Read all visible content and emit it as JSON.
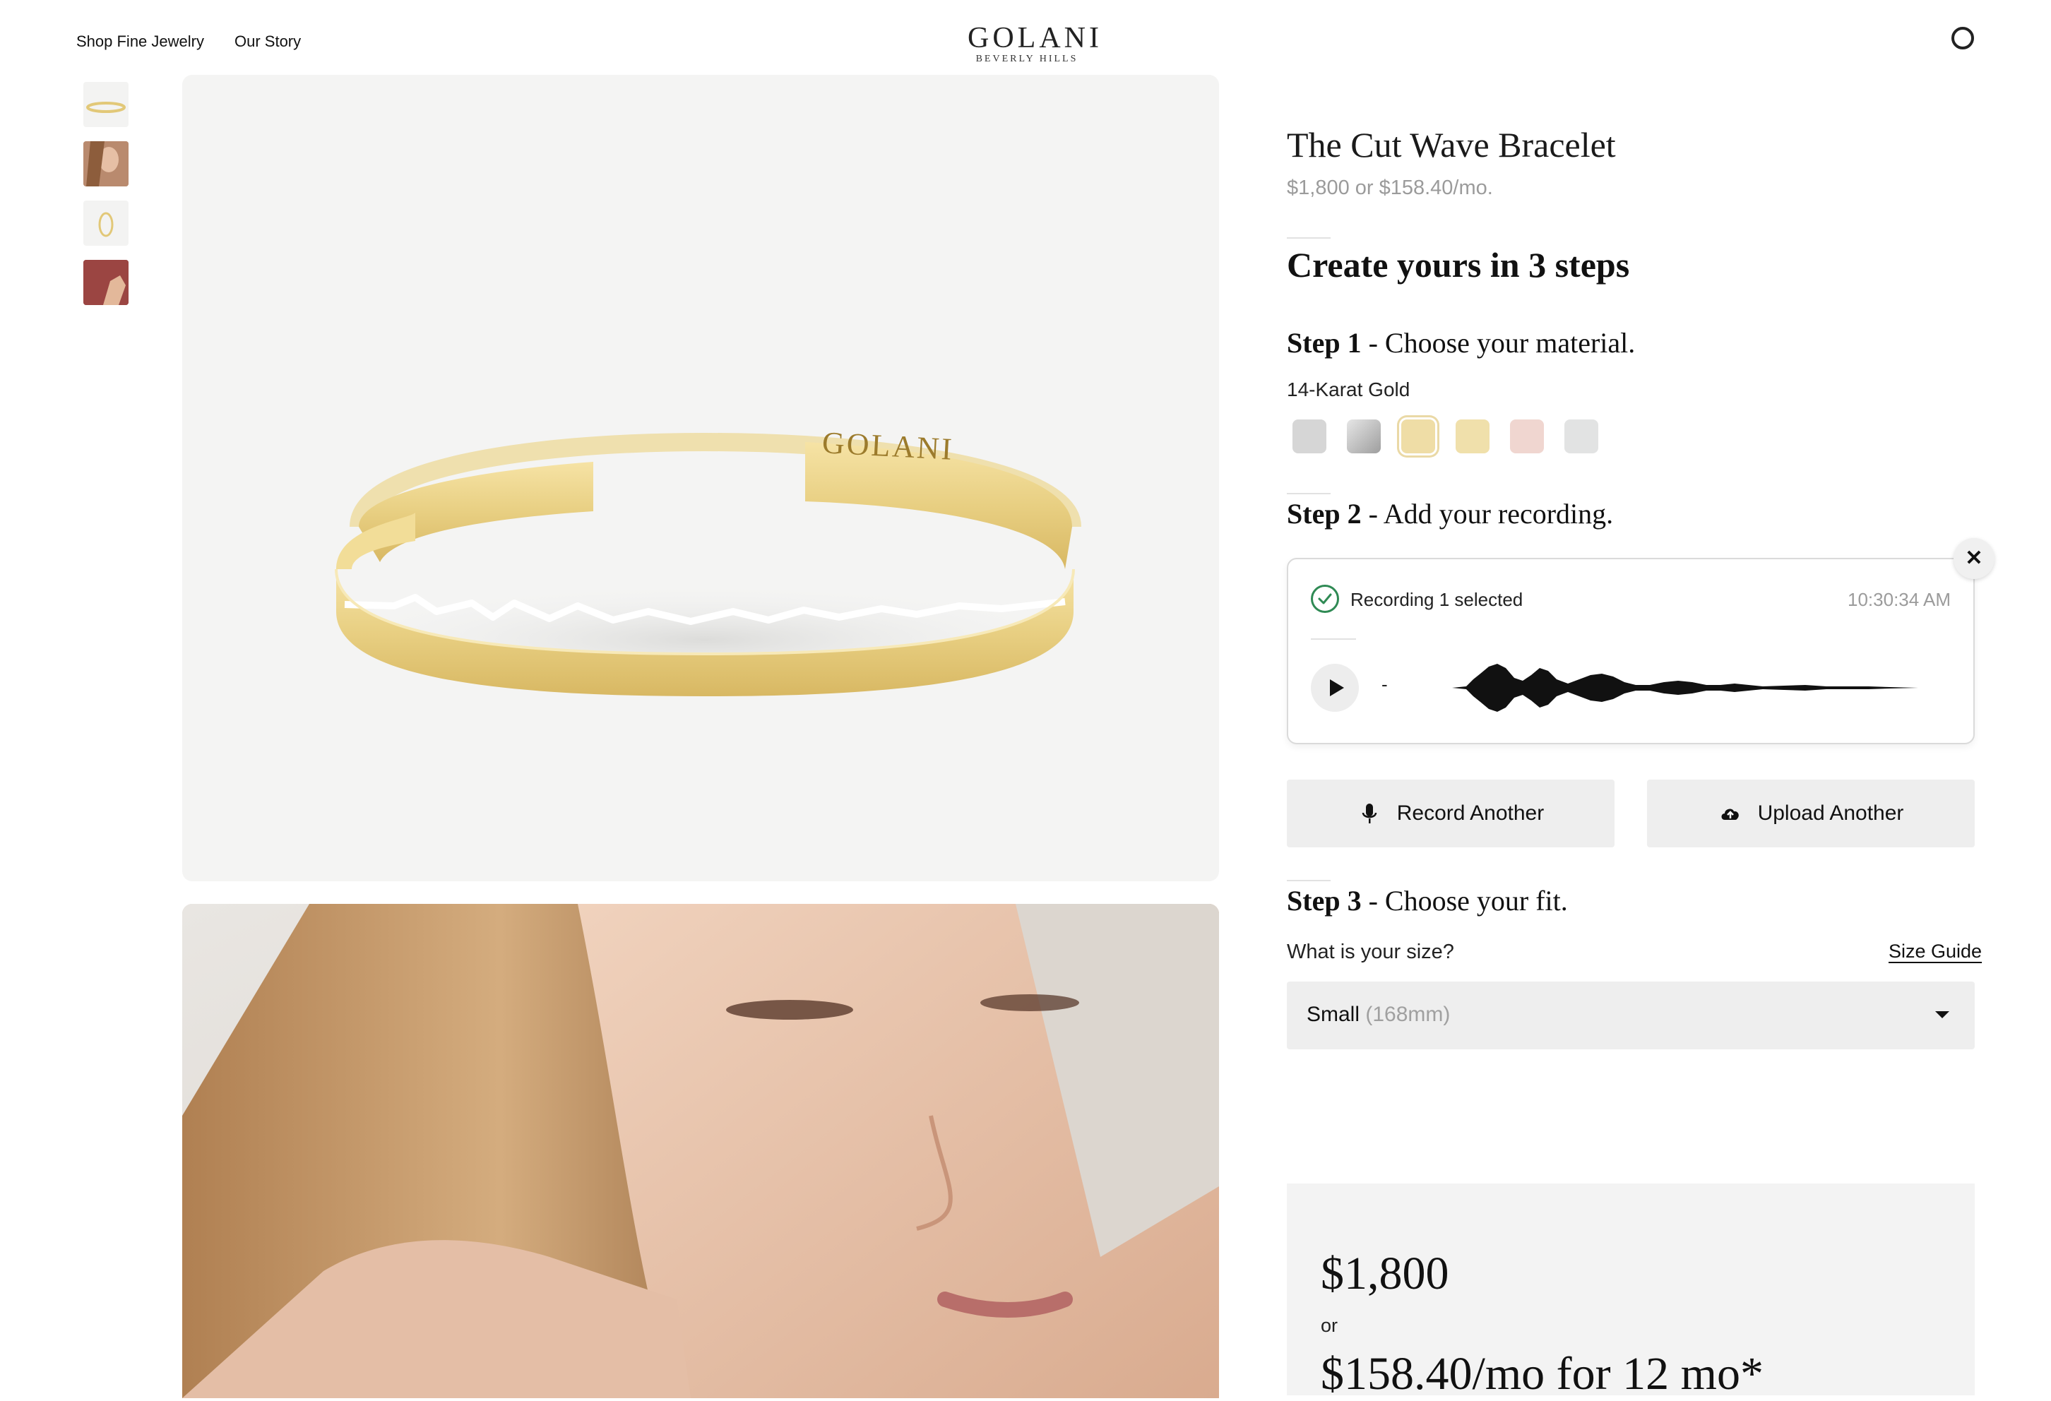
{
  "header": {
    "nav": [
      "Shop Fine Jewelry",
      "Our Story"
    ],
    "logo": "GOLANI",
    "logo_sub": "BEVERLY HILLS",
    "account_icon": "account-circle-icon"
  },
  "gallery": {
    "thumbnails": [
      "bracelet-product",
      "model-wearing",
      "bracelet-top-view",
      "model-red-background"
    ],
    "hero_engraving": "GOLANI"
  },
  "product": {
    "title": "The Cut Wave Bracelet",
    "price_line": "$1,800 or $158.40/mo."
  },
  "steps": {
    "heading": "Create yours in 3 steps",
    "step1": {
      "num": "Step 1",
      "text": " - Choose your material."
    },
    "material_label": "14-Karat Gold",
    "swatches": [
      {
        "name": "silver",
        "color": "#d6d6d6"
      },
      {
        "name": "stainless",
        "color": "#b9b9b9"
      },
      {
        "name": "14k-gold",
        "color": "#efdda6",
        "selected": true
      },
      {
        "name": "gold-vermeil",
        "color": "#f0e0ab"
      },
      {
        "name": "rose-gold",
        "color": "#f0d6d0"
      },
      {
        "name": "white-gold",
        "color": "#e2e3e3"
      }
    ],
    "step2": {
      "num": "Step 2",
      "text": " - Add your recording."
    },
    "recording": {
      "label": "Recording 1 selected",
      "time": "10:30:34 AM",
      "dash": "-"
    },
    "record_another": "Record Another",
    "upload_another": "Upload Another",
    "step3": {
      "num": "Step 3",
      "text": " - Choose your fit."
    },
    "size_question": "What is your size?",
    "size_guide": "Size Guide",
    "size_value": "Small",
    "size_detail": "(168mm)"
  },
  "price_box": {
    "price": "$1,800",
    "or": "or",
    "monthly": "$158.40/mo for 12 mo*"
  }
}
